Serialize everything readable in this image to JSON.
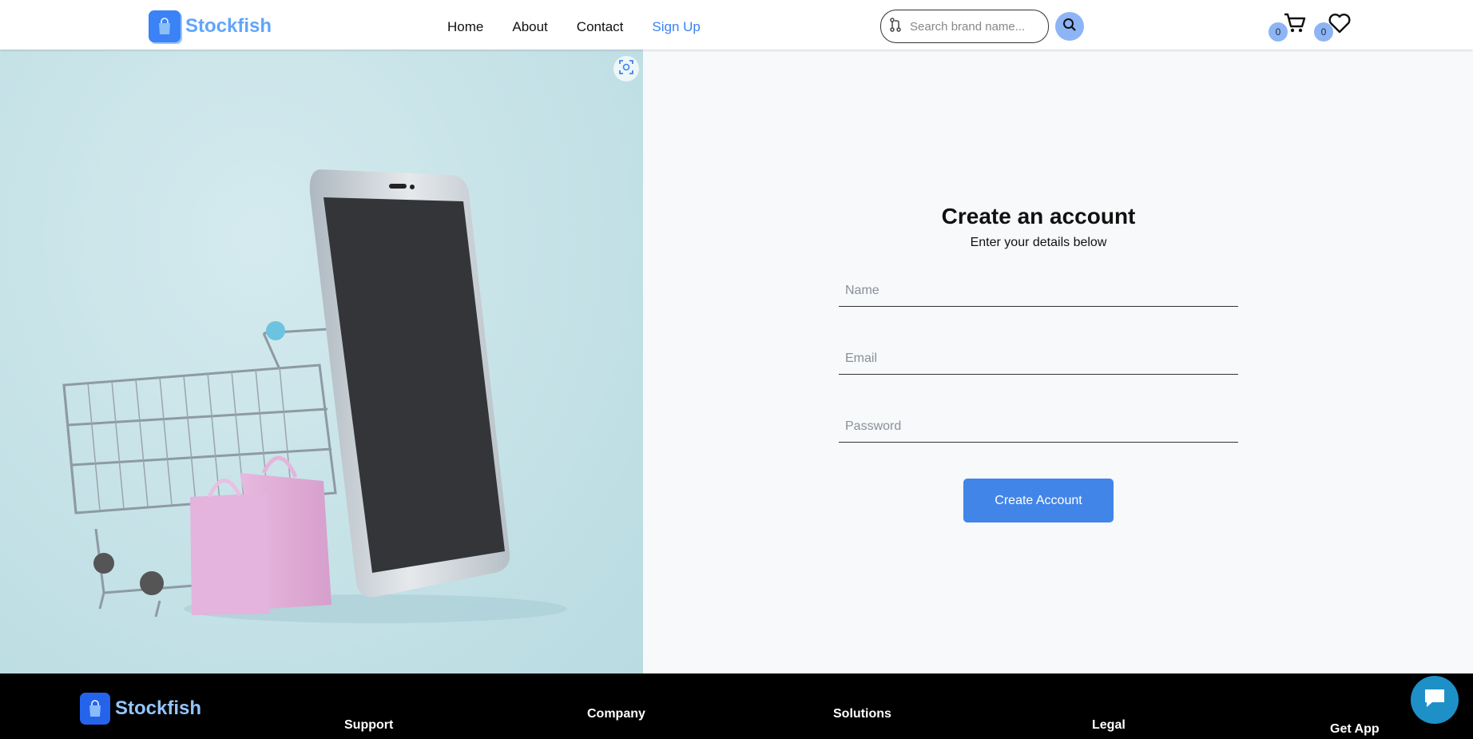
{
  "brand": {
    "name": "Stockfish"
  },
  "nav": {
    "items": [
      {
        "label": "Home"
      },
      {
        "label": "About"
      },
      {
        "label": "Contact"
      },
      {
        "label": "Sign Up",
        "active": true
      }
    ]
  },
  "search": {
    "placeholder": "Search brand name..."
  },
  "cart": {
    "count": "0",
    "icon": "cart-icon"
  },
  "wishlist": {
    "count": "0",
    "icon": "heart-icon"
  },
  "hero": {
    "image": "shopping-cart-smartphone-bags"
  },
  "form": {
    "title": "Create an account",
    "subtitle": "Enter your details below",
    "name_placeholder": "Name",
    "email_placeholder": "Email",
    "password_placeholder": "Password",
    "submit_label": "Create Account"
  },
  "footer": {
    "brand": "Stockfish",
    "columns": [
      "Support",
      "Company",
      "Solutions",
      "Legal",
      "Get App"
    ]
  },
  "colors": {
    "accent": "#3b82f6",
    "button": "#4285e8",
    "footer_bg": "#000000"
  }
}
